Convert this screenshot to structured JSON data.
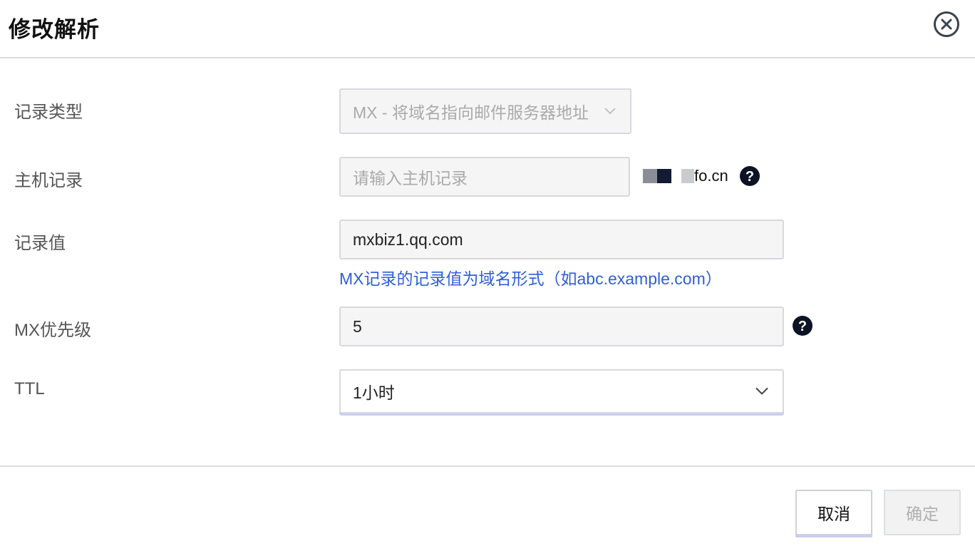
{
  "dialog": {
    "title": "修改解析"
  },
  "form": {
    "record_type": {
      "label": "记录类型",
      "value": "MX - 将域名指向邮件服务器地址"
    },
    "host": {
      "label": "主机记录",
      "placeholder": "请输入主机记录",
      "domain_suffix": "fo.cn"
    },
    "record_value": {
      "label": "记录值",
      "value": "mxbiz1.qq.com",
      "hint": "MX记录的记录值为域名形式（如abc.example.com）"
    },
    "mx_priority": {
      "label": "MX优先级",
      "value": "5"
    },
    "ttl": {
      "label": "TTL",
      "value": "1小时"
    }
  },
  "footer": {
    "cancel_label": "取消",
    "confirm_label": "确定"
  },
  "icons": {
    "close": "close-circle-icon",
    "help": "question-circle-icon",
    "chevron": "chevron-down-icon"
  },
  "colors": {
    "hint": "#2f5fd6",
    "border": "#d7d9de",
    "disabled_text": "#aaaaaa"
  }
}
